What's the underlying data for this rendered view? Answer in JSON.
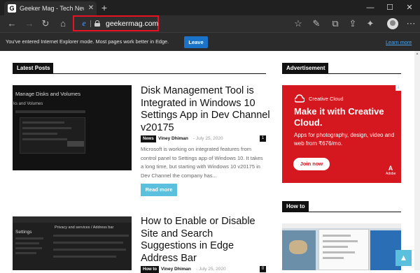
{
  "browser": {
    "tab_favicon": "G",
    "tab_title": "Geeker Mag - Tech News and Tu",
    "tab_close": "✕",
    "new_tab": "+",
    "url": "geekermag.com",
    "window_controls": {
      "minimize": "—",
      "maximize": "☐",
      "close": "✕"
    }
  },
  "ie_banner": {
    "message": "You've entered Internet Explorer mode. Most pages work better in Edge.",
    "leave_label": "Leave",
    "learn_more_label": "Learn more"
  },
  "sections": {
    "latest_posts": "Latest Posts",
    "advertisement": "Advertisement",
    "how_to": "How to"
  },
  "posts": [
    {
      "title": "Disk Management Tool is Integrated in Windows 10 Settings App in Dev Channel v20175",
      "category": "News",
      "author": "Viney Dhiman",
      "date": "- July 25, 2020",
      "comments": "1",
      "excerpt": "Microsoft is working on integrated features from control panel to Settings app of Windows 10. It takes a long time, but starting with Windows 10 v20175 in Dev Channel the company has...",
      "read_more": "Read more",
      "thumb_caption": "Manage Disks and Volumes",
      "thumb_subcaption": "ks and Volumes"
    },
    {
      "title": "How to Enable or Disable Site and Search Suggestions in Edge Address Bar",
      "category": "How to",
      "author": "Viney Dhiman",
      "date": "- July 25, 2020",
      "comments": "0",
      "thumb_caption": "Settings",
      "thumb_subcaption": "Privacy and services / Address bar"
    }
  ],
  "ad": {
    "brand": "Creative Cloud",
    "headline": "Make it with Creative Cloud.",
    "body": "Apps for photography, design, video and web from ₹676/mo.",
    "cta": "Join now",
    "adobe_label": "Adobe"
  },
  "scroll_top": "▲",
  "colors": {
    "accent": "#5bc0de",
    "ad_red": "#d5181f",
    "highlight": "#e81123",
    "edge_blue": "#1a73c8"
  }
}
